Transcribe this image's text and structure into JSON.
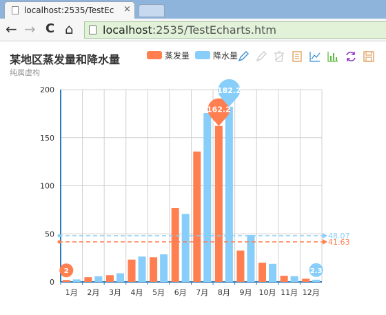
{
  "browser": {
    "tab_title": "localhost:2535/TestEc",
    "tab_close": "×",
    "url_host": "localhost",
    "url_rest": ":2535/TestEcharts.htm",
    "back": "←",
    "forward": "→",
    "reload": "C",
    "home": "⌂"
  },
  "toolbox": {
    "icons": [
      "mark-icon",
      "mark-undo-icon",
      "mark-clear-icon",
      "data-view-icon",
      "line-chart-icon",
      "bar-chart-icon",
      "restore-icon",
      "save-image-icon"
    ],
    "colors": [
      "#3b8ed3",
      "#cccccc",
      "#cccccc",
      "#e0a060",
      "#3b8ed3",
      "#5cbb3b",
      "#8b2fc9",
      "#e0a060"
    ]
  },
  "chart_data": {
    "type": "bar",
    "title": "某地区蒸发量和降水量",
    "subtitle": "纯属虚构",
    "categories": [
      "1月",
      "2月",
      "3月",
      "4月",
      "5月",
      "6月",
      "7月",
      "8月",
      "9月",
      "10月",
      "11月",
      "12月"
    ],
    "series": [
      {
        "name": "蒸发量",
        "color": "#ff7f50",
        "values": [
          2.0,
          4.9,
          7.0,
          23.2,
          25.6,
          76.7,
          135.6,
          162.2,
          32.6,
          20.0,
          6.4,
          3.3
        ],
        "mark_points": [
          {
            "label": "162.2",
            "value": 162.2,
            "index": 7
          },
          {
            "label": "2",
            "value": 2.0,
            "index": 0
          }
        ],
        "mark_line": {
          "label": "41.63",
          "value": 41.63
        }
      },
      {
        "name": "降水量",
        "color": "#87cefa",
        "values": [
          2.6,
          5.9,
          9.0,
          26.4,
          28.7,
          70.7,
          175.6,
          182.2,
          48.7,
          18.8,
          6.0,
          2.3
        ],
        "mark_points": [
          {
            "label": "182.2",
            "value": 182.2,
            "index": 7
          },
          {
            "label": "2.3",
            "value": 2.3,
            "index": 11
          }
        ],
        "mark_line": {
          "label": "48.07",
          "value": 48.07
        }
      }
    ],
    "yticks": [
      "0",
      "50",
      "100",
      "150",
      "200"
    ],
    "ylim": [
      0,
      200
    ],
    "grid": true,
    "legend_position": "top-right"
  }
}
